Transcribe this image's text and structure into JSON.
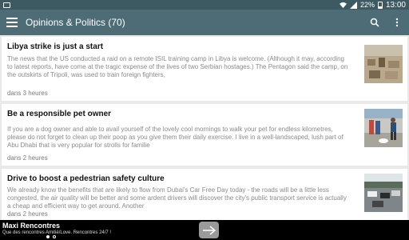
{
  "status": {
    "battery": "22%",
    "time": "13:00"
  },
  "appbar": {
    "title": "Opinions & Politics (70)"
  },
  "articles": [
    {
      "title": "Libya strike is just a start",
      "body": "The news that the US conducted a raid on a remote ISIL training camp in Libya is welcome. (Although it may, according to latest reports, have come at the tragic expense of the lives of two Serbian hostages.) The Pentagon said the camp, on the outskirts of Tripoli, was used to train foreign fighters,",
      "time": "dans 3 heures",
      "thumb": "city-aerial"
    },
    {
      "title": "Be a responsible pet owner",
      "body": "If you are a dog owner and able to avail yourself of the lovely cool mornings to walk your pet for endless kilometres, please do not forget to clean up their poop as you give them their daily exercise. I live in a well-landscaped, lush part of Abu Dhabi that is very popular for strolls for familie",
      "time": "dans 2 heures",
      "thumb": "dog-walker"
    },
    {
      "title": "Drive to boost a pedestrian safety culture",
      "body": "We already know the benefits that are likely to flow from Dubai's Car Free Day today - the roads will be a little less congested, the air quality will be better and some ardent drivers will discover the city's public transport service is actually a cheap and efficient way to get around. Another",
      "time": "dans 2 heures",
      "thumb": "traffic-road"
    }
  ],
  "ad": {
    "title": "Maxi Rencontres",
    "text": "Que des rencontres Amitié/Love. Rencontres 24/7 !"
  }
}
